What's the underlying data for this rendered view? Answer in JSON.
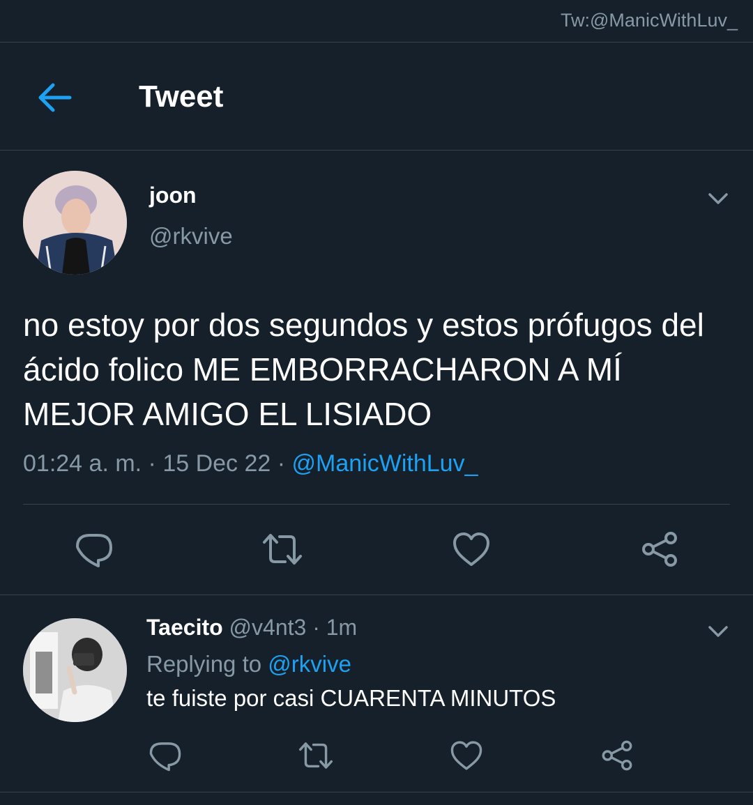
{
  "watermark": "Tw:@ManicWithLuv_",
  "header": {
    "title": "Tweet",
    "back_icon": "arrow-left-icon"
  },
  "tweet": {
    "display_name": "joon",
    "handle": "@rkvive",
    "text": "no estoy por dos segundos y estos prófugos del ácido folico ME EMBORRACHARON A MÍ MEJOR AMIGO EL LISIADO",
    "time": "01:24 a. m.",
    "separator": " · ",
    "date": "15 Dec 22",
    "via": "@ManicWithLuv_",
    "actions": [
      "reply-icon",
      "retweet-icon",
      "like-icon",
      "share-icon"
    ]
  },
  "reply": {
    "display_name": "Taecito",
    "handle": "@v4nt3",
    "time_sep": " · ",
    "time": "1m",
    "replying_prefix": "Replying to ",
    "replying_handle": "@rkvive",
    "text": "te fuiste por casi CUARENTA MINUTOS",
    "actions": [
      "reply-icon",
      "retweet-icon",
      "like-icon",
      "share-icon"
    ]
  },
  "colors": {
    "background": "#15202b",
    "divider": "#38444d",
    "accent": "#1da1f2",
    "muted": "#8899a6",
    "text": "#ffffff"
  }
}
